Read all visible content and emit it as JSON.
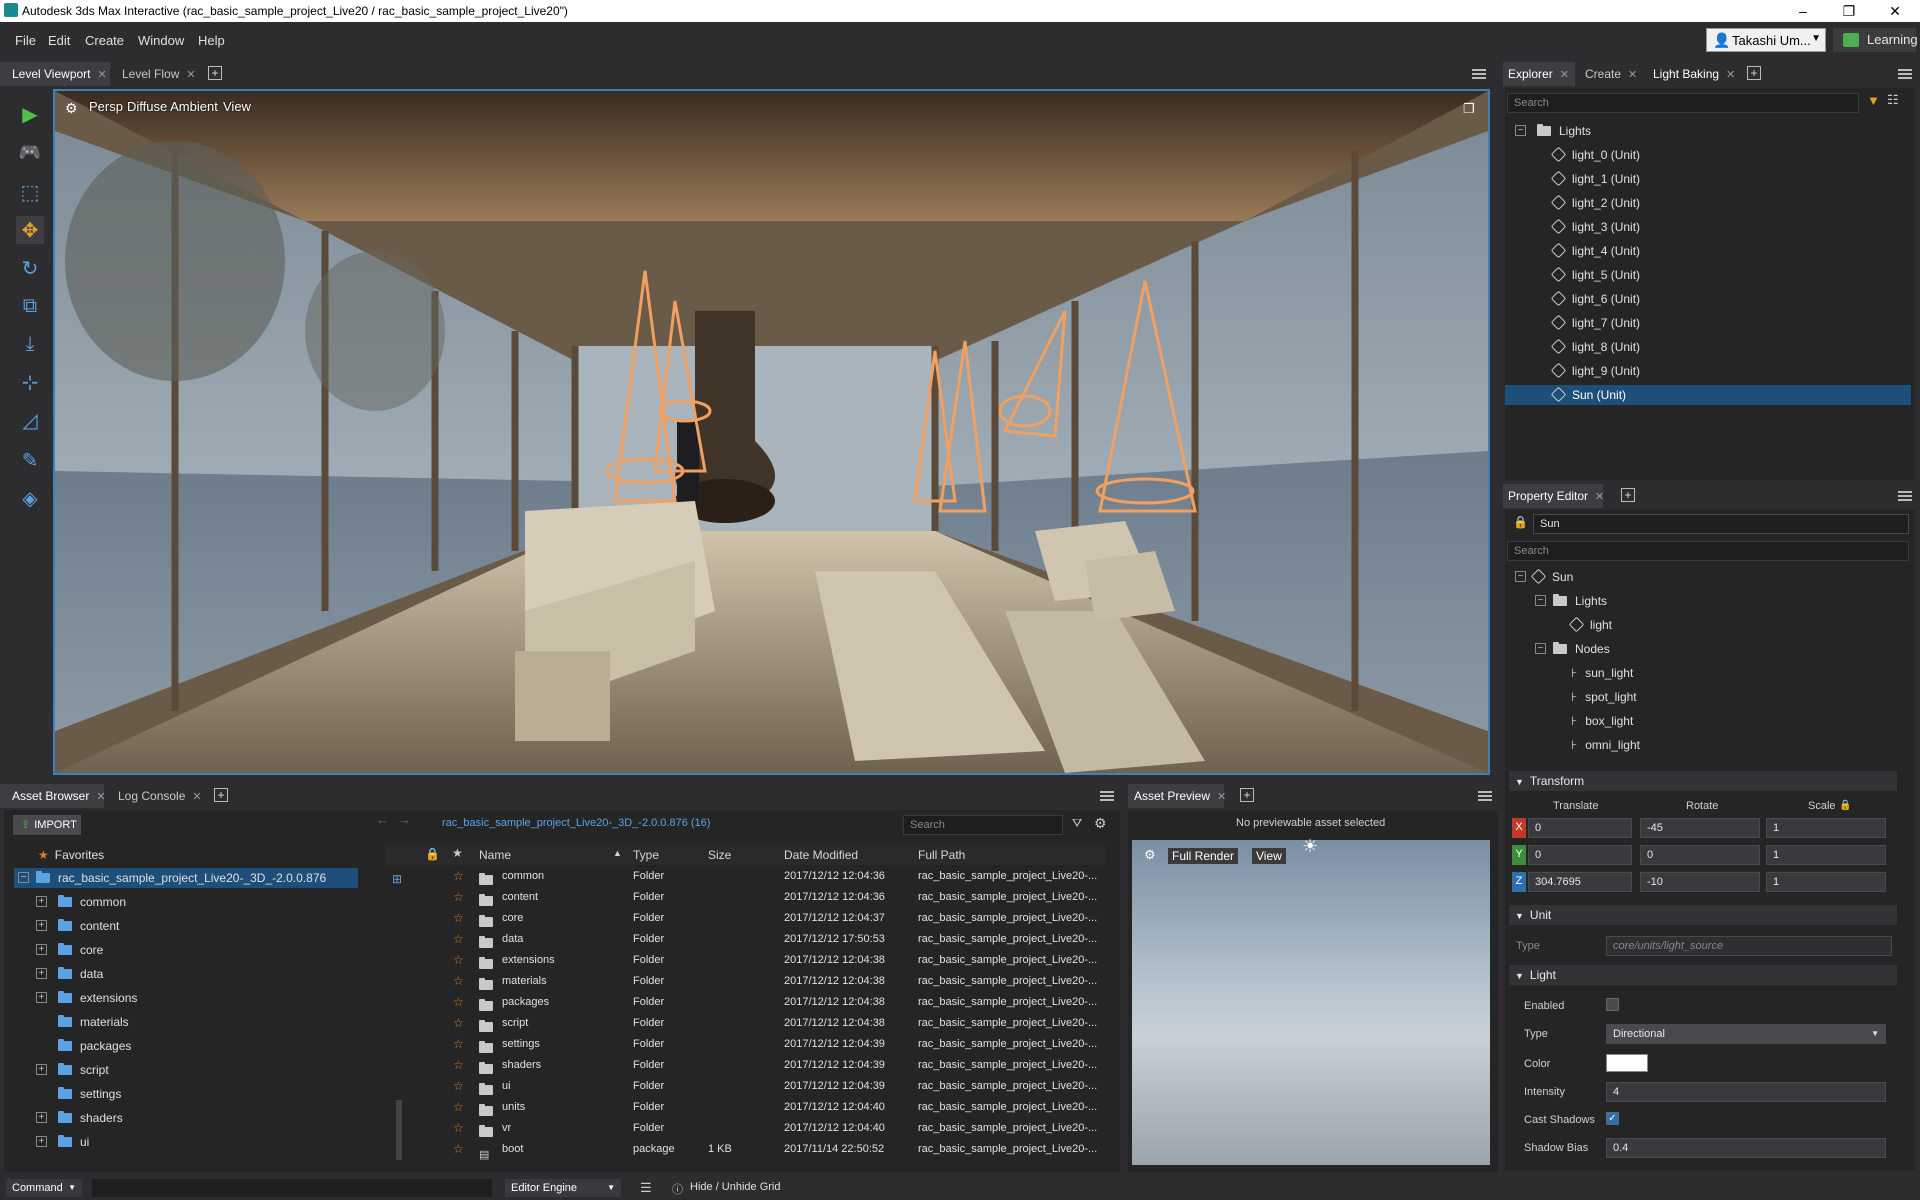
{
  "window": {
    "title": "Autodesk 3ds Max Interactive (rac_basic_sample_project_Live20 / rac_basic_sample_project_Live20\")",
    "minimize": "–",
    "maximize": "❐",
    "close": "✕"
  },
  "menu": {
    "items": [
      "File",
      "Edit",
      "Create",
      "Window",
      "Help"
    ]
  },
  "user": {
    "name": "Takashi Um...",
    "learning": "Learning"
  },
  "viewport_tabs": {
    "tabs": [
      "Level Viewport",
      "Level Flow"
    ]
  },
  "viewport": {
    "camera": "Persp",
    "shading": "Diffuse Ambient",
    "view": "View"
  },
  "explorer": {
    "tabs": [
      "Explorer",
      "Create",
      "Light Baking"
    ],
    "search_placeholder": "Search",
    "root": "Lights",
    "items": [
      "light_0 (Unit)",
      "light_1 (Unit)",
      "light_2 (Unit)",
      "light_3 (Unit)",
      "light_4 (Unit)",
      "light_5 (Unit)",
      "light_6 (Unit)",
      "light_7 (Unit)",
      "light_8 (Unit)",
      "light_9 (Unit)",
      "Sun (Unit)"
    ],
    "selected_index": 10
  },
  "property_editor": {
    "tab": "Property Editor",
    "name": "Sun",
    "search_placeholder": "Search",
    "tree": {
      "root": "Sun",
      "lights_folder": "Lights",
      "light": "light",
      "nodes_folder": "Nodes",
      "nodes": [
        "sun_light",
        "spot_light",
        "box_light",
        "omni_light"
      ]
    },
    "transform": {
      "section": "Transform",
      "headers": {
        "translate": "Translate",
        "rotate": "Rotate",
        "scale": "Scale"
      },
      "rows": [
        {
          "axis": "X",
          "translate": "0",
          "rotate": "-45",
          "scale": "1",
          "color": "#c0392b"
        },
        {
          "axis": "Y",
          "translate": "0",
          "rotate": "0",
          "scale": "1",
          "color": "#3a8f3a"
        },
        {
          "axis": "Z",
          "translate": "304.7695",
          "rotate": "-10",
          "scale": "1",
          "color": "#2f6fb0"
        }
      ]
    },
    "unit": {
      "section": "Unit",
      "type_label": "Type",
      "type_value": "core/units/light_source"
    },
    "light": {
      "section": "Light",
      "enabled_label": "Enabled",
      "enabled": false,
      "type_label": "Type",
      "type_value": "Directional",
      "color_label": "Color",
      "color_value": "#ffffff",
      "intensity_label": "Intensity",
      "intensity_value": "4",
      "cast_shadows_label": "Cast Shadows",
      "cast_shadows": true,
      "shadow_bias_label": "Shadow Bias",
      "shadow_bias_value": "0.4"
    }
  },
  "asset_browser": {
    "tabs": [
      "Asset Browser",
      "Log Console"
    ],
    "import": "IMPORT",
    "favorites": "Favorites",
    "project_root": "rac_basic_sample_project_Live20-_3D_-2.0.0.876",
    "tree": [
      "common",
      "content",
      "core",
      "data",
      "extensions",
      "materials",
      "packages",
      "script",
      "settings",
      "shaders",
      "ui"
    ],
    "breadcrumb": "rac_basic_sample_project_Live20-_3D_-2.0.0.876 (16)",
    "search_placeholder": "Search",
    "columns": {
      "name": "Name",
      "type": "Type",
      "size": "Size",
      "date": "Date Modified",
      "path": "Full Path"
    },
    "rows": [
      {
        "name": "common",
        "type": "Folder",
        "size": "",
        "date": "2017/12/12 12:04:36",
        "path": "rac_basic_sample_project_Live20-..."
      },
      {
        "name": "content",
        "type": "Folder",
        "size": "",
        "date": "2017/12/12 12:04:36",
        "path": "rac_basic_sample_project_Live20-..."
      },
      {
        "name": "core",
        "type": "Folder",
        "size": "",
        "date": "2017/12/12 12:04:37",
        "path": "rac_basic_sample_project_Live20-..."
      },
      {
        "name": "data",
        "type": "Folder",
        "size": "",
        "date": "2017/12/12 17:50:53",
        "path": "rac_basic_sample_project_Live20-..."
      },
      {
        "name": "extensions",
        "type": "Folder",
        "size": "",
        "date": "2017/12/12 12:04:38",
        "path": "rac_basic_sample_project_Live20-..."
      },
      {
        "name": "materials",
        "type": "Folder",
        "size": "",
        "date": "2017/12/12 12:04:38",
        "path": "rac_basic_sample_project_Live20-..."
      },
      {
        "name": "packages",
        "type": "Folder",
        "size": "",
        "date": "2017/12/12 12:04:38",
        "path": "rac_basic_sample_project_Live20-..."
      },
      {
        "name": "script",
        "type": "Folder",
        "size": "",
        "date": "2017/12/12 12:04:38",
        "path": "rac_basic_sample_project_Live20-..."
      },
      {
        "name": "settings",
        "type": "Folder",
        "size": "",
        "date": "2017/12/12 12:04:39",
        "path": "rac_basic_sample_project_Live20-..."
      },
      {
        "name": "shaders",
        "type": "Folder",
        "size": "",
        "date": "2017/12/12 12:04:39",
        "path": "rac_basic_sample_project_Live20-..."
      },
      {
        "name": "ui",
        "type": "Folder",
        "size": "",
        "date": "2017/12/12 12:04:39",
        "path": "rac_basic_sample_project_Live20-..."
      },
      {
        "name": "units",
        "type": "Folder",
        "size": "",
        "date": "2017/12/12 12:04:40",
        "path": "rac_basic_sample_project_Live20-..."
      },
      {
        "name": "vr",
        "type": "Folder",
        "size": "",
        "date": "2017/12/12 12:04:40",
        "path": "rac_basic_sample_project_Live20-..."
      },
      {
        "name": "boot",
        "type": "package",
        "size": "1 KB",
        "date": "2017/11/14 22:50:52",
        "path": "rac_basic_sample_project_Live20-..."
      }
    ]
  },
  "asset_preview": {
    "tab": "Asset Preview",
    "message": "No previewable asset selected",
    "render": "Full Render",
    "view": "View"
  },
  "statusbar": {
    "command": "Command",
    "engine": "Editor Engine",
    "grid": "Hide / Unhide Grid"
  }
}
